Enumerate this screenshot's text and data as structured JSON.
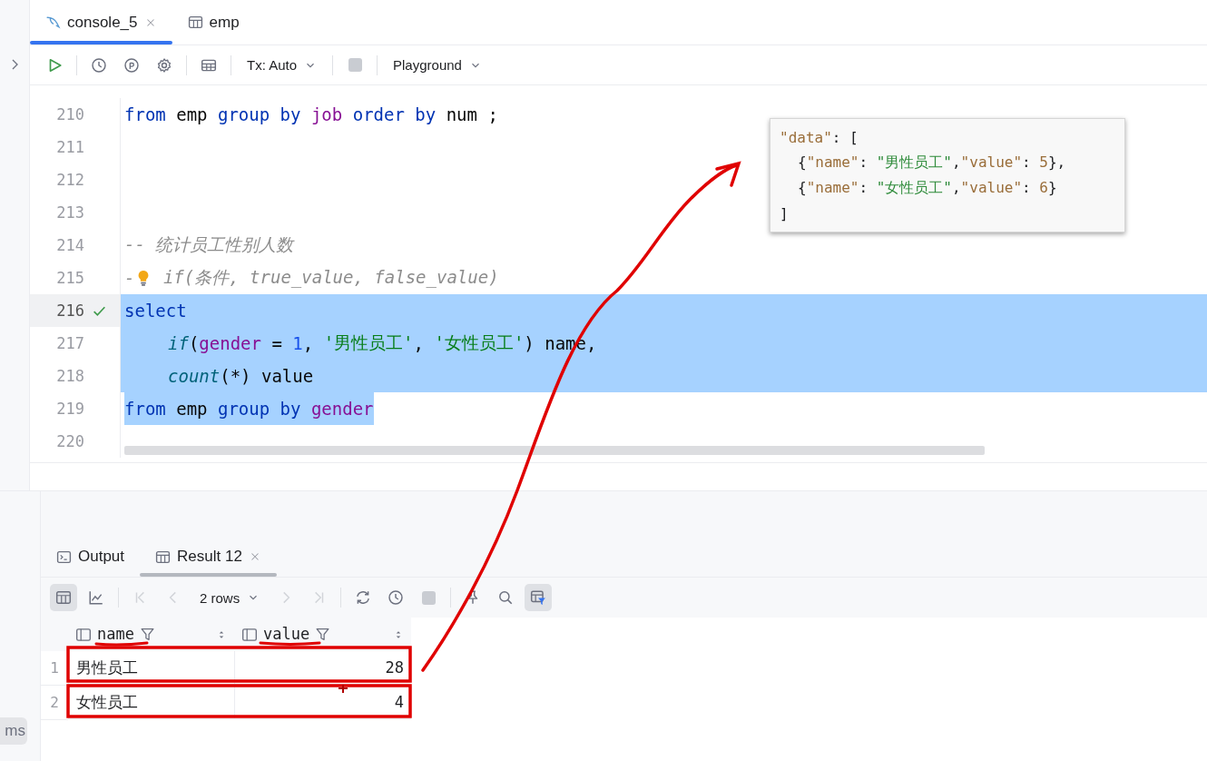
{
  "tabs": [
    {
      "label": "console_5",
      "kind": "console",
      "selected": true,
      "closable": true
    },
    {
      "label": "emp",
      "kind": "table",
      "selected": false,
      "closable": false
    }
  ],
  "toolbar": [
    {
      "kind": "run"
    },
    {
      "kind": "separator"
    },
    {
      "kind": "history"
    },
    {
      "kind": "parameter"
    },
    {
      "kind": "settings"
    },
    {
      "kind": "separator"
    },
    {
      "kind": "grid"
    },
    {
      "kind": "separator"
    },
    {
      "kind": "dropdown",
      "label": "Tx: Auto"
    },
    {
      "kind": "separator"
    },
    {
      "kind": "stop",
      "disabled": true
    },
    {
      "kind": "separator"
    },
    {
      "kind": "dropdown",
      "label": "Playground"
    }
  ],
  "editor": {
    "lines": [
      {
        "number": "210",
        "selected": false,
        "tokens": [
          {
            "text": "from ",
            "kind": "keyword"
          },
          {
            "text": "emp ",
            "kind": "plain"
          },
          {
            "text": "group by ",
            "kind": "keyword"
          },
          {
            "text": "job ",
            "kind": "column"
          },
          {
            "text": "order by ",
            "kind": "keyword"
          },
          {
            "text": "num ;",
            "kind": "plain"
          }
        ]
      },
      {
        "number": "211",
        "selected": false
      },
      {
        "number": "212",
        "selected": false
      },
      {
        "number": "213",
        "selected": false
      },
      {
        "number": "214",
        "selected": false,
        "tokens": [
          {
            "text": "-- 统计员工性别人数",
            "kind": "comment"
          }
        ]
      },
      {
        "number": "215",
        "selected": false,
        "tokens": [
          {
            "text": "-",
            "kind": "comment"
          },
          {
            "kind": "bulb"
          },
          {
            "text": " if(条件, true_value, false_value)",
            "kind": "comment"
          }
        ]
      },
      {
        "number": "216",
        "selected": true,
        "full_width": true,
        "current": true,
        "checked": true,
        "tokens": [
          {
            "text": "select",
            "kind": "keyword"
          }
        ]
      },
      {
        "number": "217",
        "selected": true,
        "full_width": true,
        "indented": true,
        "tokens": [
          {
            "text": "if",
            "kind": "function"
          },
          {
            "text": "(",
            "kind": "plain"
          },
          {
            "text": "gender",
            "kind": "column"
          },
          {
            "text": " = ",
            "kind": "plain"
          },
          {
            "text": "1",
            "kind": "number"
          },
          {
            "text": ", ",
            "kind": "plain"
          },
          {
            "text": "'男性员工'",
            "kind": "string"
          },
          {
            "text": ", ",
            "kind": "plain"
          },
          {
            "text": "'女性员工'",
            "kind": "string"
          },
          {
            "text": ") name,",
            "kind": "plain"
          }
        ]
      },
      {
        "number": "218",
        "selected": true,
        "full_width": true,
        "indented": true,
        "tokens": [
          {
            "text": "count",
            "kind": "function"
          },
          {
            "text": "(*) value",
            "kind": "plain"
          }
        ]
      },
      {
        "number": "219",
        "selected": true,
        "full_width": false,
        "tokens": [
          {
            "text": "from ",
            "kind": "keyword"
          },
          {
            "text": "emp ",
            "kind": "plain"
          },
          {
            "text": "group by ",
            "kind": "keyword"
          },
          {
            "text": "gender",
            "kind": "column"
          }
        ]
      },
      {
        "number": "220",
        "selected": false
      }
    ]
  },
  "popup": {
    "lines": [
      {
        "indented": false,
        "tokens": [
          {
            "text": "\"data\"",
            "kind": "key"
          },
          {
            "text": ": [",
            "kind": "punct"
          }
        ]
      },
      {
        "indented": true,
        "tokens": [
          {
            "text": "{",
            "kind": "punct"
          },
          {
            "text": "\"name\"",
            "kind": "key"
          },
          {
            "text": ": ",
            "kind": "punct"
          },
          {
            "text": "\"男性员工\"",
            "kind": "string"
          },
          {
            "text": ",",
            "kind": "punct"
          },
          {
            "text": "\"value\"",
            "kind": "key"
          },
          {
            "text": ": ",
            "kind": "punct"
          },
          {
            "text": "5",
            "kind": "number"
          },
          {
            "text": "},",
            "kind": "punct"
          }
        ]
      },
      {
        "indented": true,
        "tokens": [
          {
            "text": "{",
            "kind": "punct"
          },
          {
            "text": "\"name\"",
            "kind": "key"
          },
          {
            "text": ": ",
            "kind": "punct"
          },
          {
            "text": "\"女性员工\"",
            "kind": "string"
          },
          {
            "text": ",",
            "kind": "punct"
          },
          {
            "text": "\"value\"",
            "kind": "key"
          },
          {
            "text": ": ",
            "kind": "punct"
          },
          {
            "text": "6",
            "kind": "number"
          },
          {
            "text": "}",
            "kind": "punct"
          }
        ]
      },
      {
        "indented": false,
        "tokens": [
          {
            "text": "]",
            "kind": "punct"
          }
        ]
      }
    ]
  },
  "results": {
    "tabs": [
      {
        "label": "Output",
        "kind": "output",
        "selected": false,
        "closable": false
      },
      {
        "label": "Result 12",
        "kind": "table",
        "selected": true,
        "closable": true
      }
    ],
    "toolbar": [
      {
        "kind": "grid-view",
        "selected": true
      },
      {
        "kind": "chart-view",
        "selected": false
      },
      {
        "kind": "separator"
      },
      {
        "kind": "first",
        "disabled": true
      },
      {
        "kind": "prev",
        "disabled": true
      },
      {
        "kind": "dropdown",
        "label": "2 rows"
      },
      {
        "kind": "next",
        "disabled": true
      },
      {
        "kind": "last",
        "disabled": true
      },
      {
        "kind": "separator"
      },
      {
        "kind": "refresh"
      },
      {
        "kind": "history"
      },
      {
        "kind": "stop",
        "disabled": true
      },
      {
        "kind": "separator"
      },
      {
        "kind": "pin"
      },
      {
        "kind": "search"
      },
      {
        "kind": "filter-view",
        "selected": true
      }
    ],
    "columns": [
      {
        "name": "name",
        "numeric": false
      },
      {
        "name": "value",
        "numeric": true
      }
    ],
    "rows": [
      {
        "number": "1",
        "cells": [
          "男性员工",
          "28"
        ]
      },
      {
        "number": "2",
        "cells": [
          "女性员工",
          "4"
        ]
      }
    ]
  },
  "side": {
    "chip": "ms"
  }
}
